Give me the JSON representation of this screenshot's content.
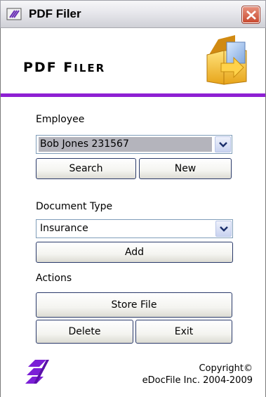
{
  "window": {
    "title": "PDF Filer",
    "close_icon": "close-icon",
    "app_icon": "pdf-filer-app-icon"
  },
  "header": {
    "title_big_1": "PDF F",
    "title_small_1": "ILER",
    "logo_icon": "document-transfer-icon",
    "rule_color": "#8e1fd3"
  },
  "employee": {
    "label": "Employee",
    "selected": "Bob Jones 231567",
    "search_label": "Search",
    "new_label": "New"
  },
  "document_type": {
    "label": "Document Type",
    "selected": "Insurance",
    "add_label": "Add"
  },
  "actions": {
    "label": "Actions",
    "store_label": "Store File",
    "delete_label": "Delete",
    "exit_label": "Exit"
  },
  "footer": {
    "brand_icon": "edocfile-logo-icon",
    "copyright_line1": "Copyright©",
    "copyright_line2": "eDocFile Inc. 2004-2009"
  }
}
